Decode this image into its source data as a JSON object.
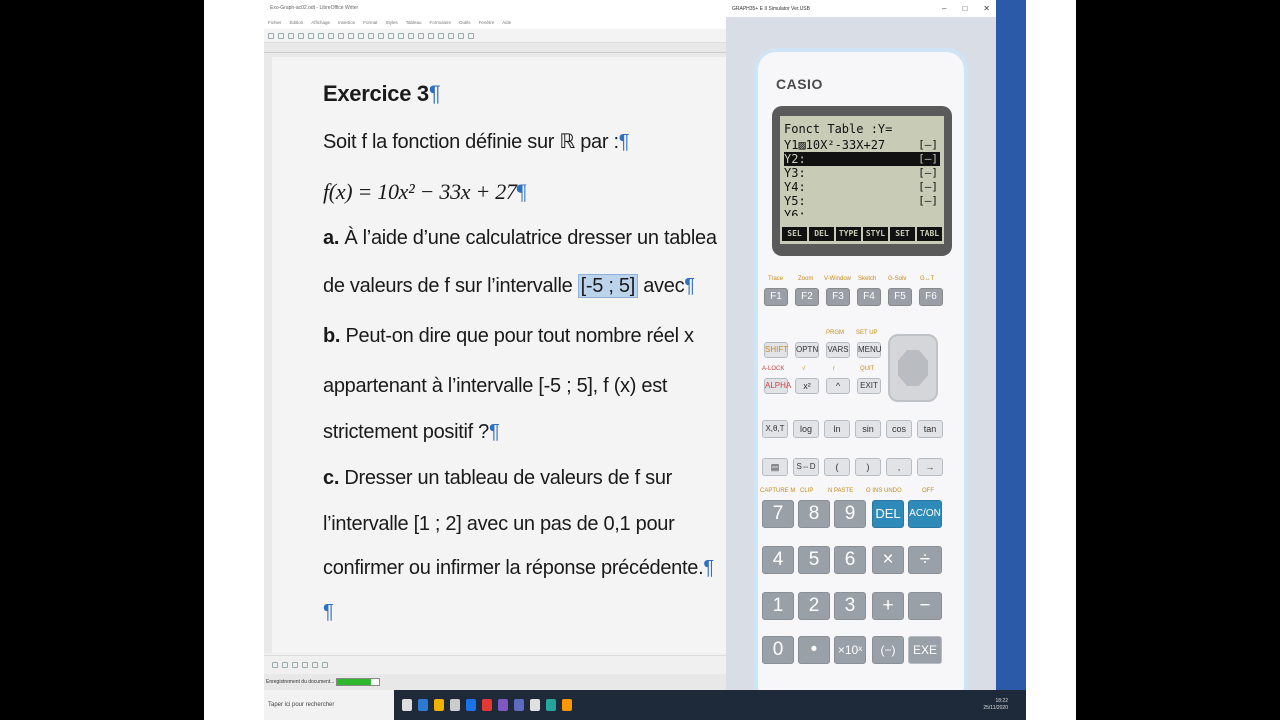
{
  "writer": {
    "title": "Exo-Graph-ac02.odt - LibreOffice Writer",
    "menu": [
      "Fichier",
      "Édition",
      "Affichage",
      "Insertion",
      "Format",
      "Styles",
      "Tableau",
      "Formulaire",
      "Outils",
      "Fenêtre",
      "Aide"
    ],
    "status_text": "Enregistrement du document...",
    "progress": 0.8,
    "doc": {
      "heading": "Exercice 3",
      "l1": "Soit f la fonction définie sur ℝ par :",
      "l2": "f(x) = 10x² − 33x + 27",
      "l3_label": "a.",
      "l3": "À l’aide d’une calculatrice dresser un tablea",
      "l4a": "de valeurs de f sur l’intervalle ",
      "l4_sel": "[-5 ; 5]",
      "l4b": " avec",
      "l5_label": "b.",
      "l5": "Peut-on dire que pour tout nombre réel x",
      "l6": "appartenant à l’intervalle [-5 ; 5], f (x) est",
      "l7": "strictement positif ?",
      "l8_label": "c.",
      "l8": "Dresser un tableau de valeurs de f sur",
      "l9": "l’intervalle [1 ; 2] avec un pas de 0,1 pour",
      "l10": "confirmer ou infirmer la réponse précédente.",
      "pilcrow": "¶"
    }
  },
  "calc": {
    "window_title": "GRAPH35+ E II Simulator Ver.USB",
    "brand": "CASIO",
    "lcd": {
      "header": "Fonct Table :Y=",
      "y1": "Y1▨10X²-33X+27",
      "y1_brk": "[—]",
      "y2": "Y2:",
      "y3": "Y3:",
      "y4": "Y4:",
      "y5": "Y5:",
      "y6": "Y6:",
      "brk": "[—]",
      "softkeys": [
        "SEL",
        "DEL",
        "TYPE",
        "STYL",
        "SET",
        "TABL"
      ]
    },
    "flabels": [
      "Trace",
      "Zoom",
      "V-Window",
      "Sketch",
      "G-Solv",
      "G↔T"
    ],
    "fkeys": [
      "F1",
      "F2",
      "F3",
      "F4",
      "F5",
      "F6"
    ],
    "row1_top": [
      "",
      "",
      "PRGM",
      "SET UP"
    ],
    "row1": [
      "SHIFT",
      "OPTN",
      "VARS",
      "MENU"
    ],
    "row2_top": [
      "A-LOCK",
      "√",
      "r",
      "QUIT"
    ],
    "row2": [
      "ALPHA",
      "x²",
      "^",
      "EXIT"
    ],
    "row3": [
      "X,θ,T",
      "log",
      "ln",
      "sin",
      "cos",
      "tan"
    ],
    "row4": [
      "▤",
      "S⇔D",
      "(",
      ")",
      ",",
      "→"
    ],
    "num_top1": [
      "CAPTURE M",
      "CLIP",
      "N PASTE",
      "O INS UNDO",
      "OFF"
    ],
    "num1": [
      "7",
      "8",
      "9",
      "DEL",
      "AC/ON"
    ],
    "num2": [
      "4",
      "5",
      "6",
      "×",
      "÷"
    ],
    "num3": [
      "1",
      "2",
      "3",
      "+",
      "−"
    ],
    "num4": [
      "0",
      "•",
      "×10ˣ",
      "(−)",
      "EXE"
    ]
  },
  "taskbar": {
    "search": "Taper ici pour rechercher",
    "time": "18:22",
    "date": "25/11/2020"
  }
}
